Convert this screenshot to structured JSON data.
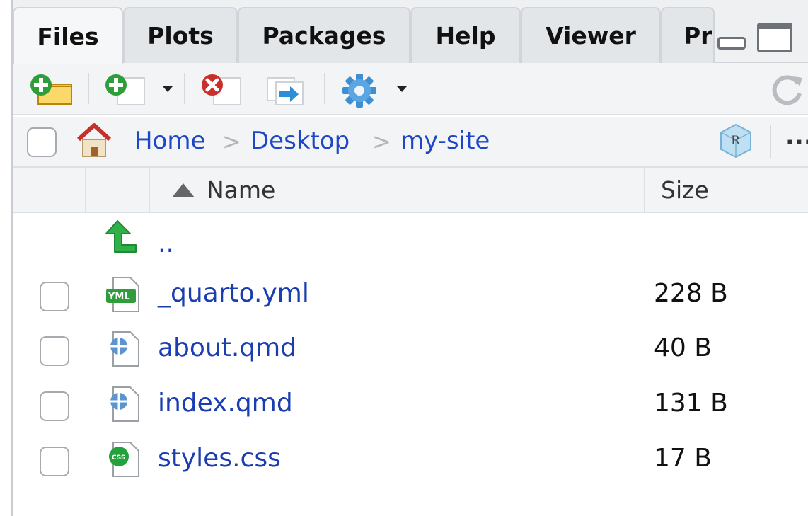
{
  "tabs": [
    {
      "label": "Files",
      "active": true
    },
    {
      "label": "Plots",
      "active": false
    },
    {
      "label": "Packages",
      "active": false
    },
    {
      "label": "Help",
      "active": false
    },
    {
      "label": "Viewer",
      "active": false
    },
    {
      "label": "Pr",
      "active": false
    }
  ],
  "toolbar": {
    "icons": [
      "new-folder-icon",
      "new-file-icon",
      "delete-icon",
      "rename-icon",
      "gear-icon",
      "refresh-icon"
    ]
  },
  "breadcrumb": {
    "items": [
      "Home",
      "Desktop",
      "my-site"
    ],
    "separator": ">",
    "more_label": "..."
  },
  "columns": {
    "name": "Name",
    "size": "Size",
    "sort": "ascending"
  },
  "parent_dir": {
    "label": ".."
  },
  "files": [
    {
      "name": "_quarto.yml",
      "size": "228 B",
      "icon": "yml-file-icon"
    },
    {
      "name": "about.qmd",
      "size": "40 B",
      "icon": "quarto-file-icon"
    },
    {
      "name": "index.qmd",
      "size": "131 B",
      "icon": "quarto-file-icon"
    },
    {
      "name": "styles.css",
      "size": "17 B",
      "icon": "css-file-icon"
    }
  ],
  "colors": {
    "link": "#1a3db0",
    "crumb": "#1d46c8",
    "bar_bg": "#f2f4f5",
    "tab_bg": "#e3e6e9"
  }
}
